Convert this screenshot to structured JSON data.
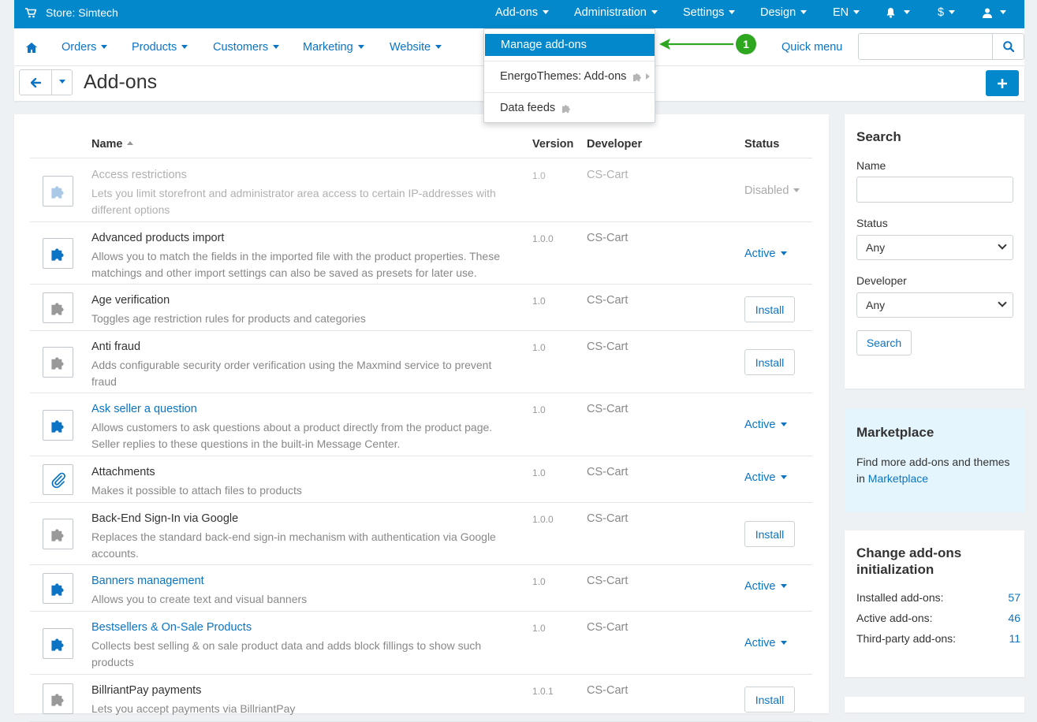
{
  "topbar": {
    "store": "Store: Simtech",
    "menus": [
      "Add-ons",
      "Administration",
      "Settings",
      "Design",
      "EN"
    ],
    "currency": "$",
    "icons": [
      "cart-icon",
      "bell-icon",
      "user-icon"
    ]
  },
  "nav": {
    "items": [
      "Orders",
      "Products",
      "Customers",
      "Marketing",
      "Website"
    ],
    "quick_menu": "Quick menu",
    "search_placeholder": ""
  },
  "page": {
    "title": "Add-ons"
  },
  "dropdown": {
    "items": [
      "Manage add-ons",
      "EnergoThemes: Add-ons",
      "Data feeds"
    ]
  },
  "callout": {
    "number": "1"
  },
  "table": {
    "headers": {
      "name": "Name",
      "version": "Version",
      "developer": "Developer",
      "status": "Status"
    },
    "rows": [
      {
        "name": "Access restrictions",
        "desc": "Lets you limit storefront and administrator area access to certain IP-addresses with different options",
        "version": "1.0",
        "developer": "CS-Cart",
        "status": "Disabled",
        "kind": "disabled",
        "icon": "puzzle-icon"
      },
      {
        "name": "Advanced products import",
        "desc": "Allows you to match the fields in the imported file with the product properties. These matchings and other import settings can also be saved as presets for later use.",
        "version": "1.0.0",
        "developer": "CS-Cart",
        "status": "Active",
        "kind": "active",
        "icon": "puzzle-icon"
      },
      {
        "name": "Age verification",
        "desc": "Toggles age restriction rules for products and categories",
        "version": "1.0",
        "developer": "CS-Cart",
        "status": "Install",
        "kind": "install",
        "icon": "puzzle-icon"
      },
      {
        "name": "Anti fraud",
        "desc": "Adds configurable security order verification using the Maxmind service to prevent fraud",
        "version": "1.0",
        "developer": "CS-Cart",
        "status": "Install",
        "kind": "install",
        "icon": "puzzle-icon"
      },
      {
        "name": "Ask seller a question",
        "desc": "Allows customers to ask questions about a product directly from the product page. Seller replies to these questions in the built-in Message Center.",
        "version": "1.0",
        "developer": "CS-Cart",
        "status": "Active",
        "kind": "active",
        "link": true,
        "icon": "puzzle-icon"
      },
      {
        "name": "Attachments",
        "desc": "Makes it possible to attach files to products",
        "version": "1.0",
        "developer": "CS-Cart",
        "status": "Active",
        "kind": "active",
        "icon": "paperclip-icon"
      },
      {
        "name": "Back-End Sign-In via Google",
        "desc": "Replaces the standard back-end sign-in mechanism with authentication via Google accounts.",
        "version": "1.0.0",
        "developer": "CS-Cart",
        "status": "Install",
        "kind": "install",
        "icon": "puzzle-icon"
      },
      {
        "name": "Banners management",
        "desc": "Allows you to create text and visual banners",
        "version": "1.0",
        "developer": "CS-Cart",
        "status": "Active",
        "kind": "active",
        "link": true,
        "icon": "puzzle-icon"
      },
      {
        "name": "Bestsellers & On-Sale Products",
        "desc": "Collects best selling & on sale product data and adds block fillings to show such products",
        "version": "1.0",
        "developer": "CS-Cart",
        "status": "Active",
        "kind": "active",
        "link": true,
        "icon": "puzzle-icon"
      },
      {
        "name": "BillriantPay payments",
        "desc": "Lets you accept payments via BillriantPay",
        "version": "1.0.1",
        "developer": "CS-Cart",
        "status": "Install",
        "kind": "install",
        "icon": "puzzle-icon"
      }
    ]
  },
  "search_panel": {
    "title": "Search",
    "name_label": "Name",
    "status_label": "Status",
    "status_value": "Any",
    "developer_label": "Developer",
    "developer_value": "Any",
    "button": "Search"
  },
  "marketplace": {
    "title": "Marketplace",
    "text": "Find more add-ons and themes in",
    "link": "Marketplace"
  },
  "stats": {
    "title": "Change add-ons initialization",
    "lines": [
      {
        "label": "Installed add-ons:",
        "value": "57"
      },
      {
        "label": "Active add-ons:",
        "value": "46"
      },
      {
        "label": "Third-party add-ons:",
        "value": "11"
      }
    ]
  },
  "colors": {
    "primary": "#0388cc",
    "link": "#0b74c4",
    "callout": "#2ea61f"
  }
}
